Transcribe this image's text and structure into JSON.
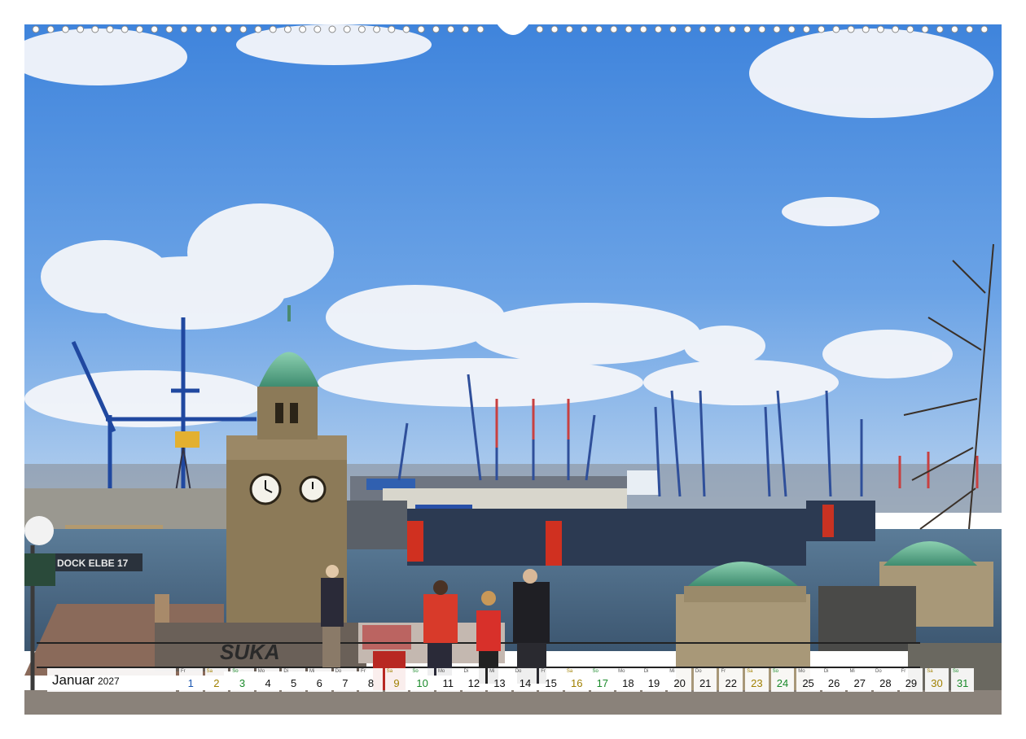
{
  "calendar": {
    "month": "Januar",
    "year": "2027",
    "days": [
      {
        "wd": "Fr",
        "d": "1",
        "t": "fri"
      },
      {
        "wd": "Sa",
        "d": "2",
        "t": "sat"
      },
      {
        "wd": "So",
        "d": "3",
        "t": "sun"
      },
      {
        "wd": "Mo",
        "d": "4",
        "t": ""
      },
      {
        "wd": "Di",
        "d": "5",
        "t": ""
      },
      {
        "wd": "Mi",
        "d": "6",
        "t": ""
      },
      {
        "wd": "Do",
        "d": "7",
        "t": ""
      },
      {
        "wd": "Fr",
        "d": "8",
        "t": ""
      },
      {
        "wd": "Sa",
        "d": "9",
        "t": "sat"
      },
      {
        "wd": "So",
        "d": "10",
        "t": "sun"
      },
      {
        "wd": "Mo",
        "d": "11",
        "t": ""
      },
      {
        "wd": "Di",
        "d": "12",
        "t": ""
      },
      {
        "wd": "Mi",
        "d": "13",
        "t": ""
      },
      {
        "wd": "Do",
        "d": "14",
        "t": ""
      },
      {
        "wd": "Fr",
        "d": "15",
        "t": ""
      },
      {
        "wd": "Sa",
        "d": "16",
        "t": "sat"
      },
      {
        "wd": "So",
        "d": "17",
        "t": "sun"
      },
      {
        "wd": "Mo",
        "d": "18",
        "t": ""
      },
      {
        "wd": "Di",
        "d": "19",
        "t": ""
      },
      {
        "wd": "Mi",
        "d": "20",
        "t": ""
      },
      {
        "wd": "Do",
        "d": "21",
        "t": ""
      },
      {
        "wd": "Fr",
        "d": "22",
        "t": ""
      },
      {
        "wd": "Sa",
        "d": "23",
        "t": "sat"
      },
      {
        "wd": "So",
        "d": "24",
        "t": "sun"
      },
      {
        "wd": "Mo",
        "d": "25",
        "t": ""
      },
      {
        "wd": "Di",
        "d": "26",
        "t": ""
      },
      {
        "wd": "Mi",
        "d": "27",
        "t": ""
      },
      {
        "wd": "Do",
        "d": "28",
        "t": ""
      },
      {
        "wd": "Fr",
        "d": "29",
        "t": ""
      },
      {
        "wd": "Sa",
        "d": "30",
        "t": "sat"
      },
      {
        "wd": "So",
        "d": "31",
        "t": "sun"
      }
    ]
  },
  "photo": {
    "dock_sign": "DOCK ELBE 17",
    "graffiti": "SUKA"
  },
  "colors": {
    "sky": "#4f8fe0",
    "water": "#4a6a86",
    "copper_roof": "#5aa88a",
    "crane_blue": "#2a4fa0"
  }
}
